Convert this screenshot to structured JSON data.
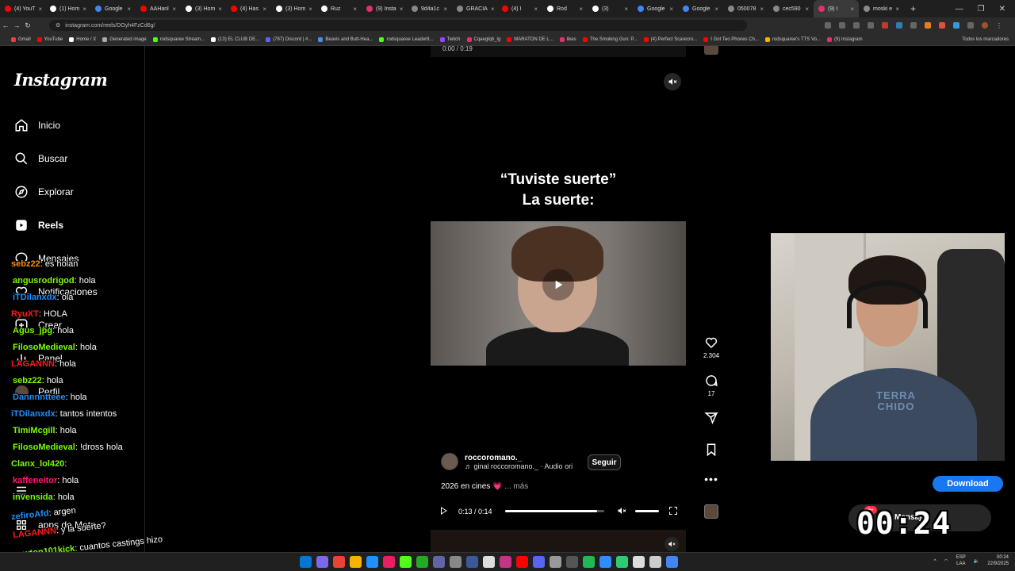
{
  "browser": {
    "tabs": [
      {
        "label": "(4) YouT",
        "color": "#ff0000"
      },
      {
        "label": "(1) Hom",
        "color": "#ffffff"
      },
      {
        "label": "Google",
        "color": "#4285f4"
      },
      {
        "label": "AAHanl",
        "color": "#ff0000"
      },
      {
        "label": "(3) Hom",
        "color": "#ffffff"
      },
      {
        "label": "(4) Has",
        "color": "#ff0000"
      },
      {
        "label": "(3) Hom",
        "color": "#ffffff"
      },
      {
        "label": "Ruz",
        "color": "#ffffff"
      },
      {
        "label": "(9) Insta",
        "color": "#e1306c"
      },
      {
        "label": "9d4a1c",
        "color": "#888888"
      },
      {
        "label": "GRACIA",
        "color": "#888888"
      },
      {
        "label": "(4) I",
        "color": "#ff0000"
      },
      {
        "label": "Rod",
        "color": "#ffffff"
      },
      {
        "label": "(3) ",
        "color": "#ffffff"
      },
      {
        "label": "Google",
        "color": "#4285f4"
      },
      {
        "label": "Google",
        "color": "#4285f4"
      },
      {
        "label": "050078",
        "color": "#888888"
      },
      {
        "label": "cec590",
        "color": "#888888"
      },
      {
        "label": "(9) I",
        "color": "#e1306c"
      },
      {
        "label": "moski e",
        "color": "#888888"
      }
    ],
    "active_tab_index": 18,
    "new_tab": "+",
    "url": "instagram.com/reels/DOyh4FzCd6g/",
    "bookmarks": [
      {
        "label": "Gmail",
        "color": "#ea4335"
      },
      {
        "label": "YouTube",
        "color": "#ff0000"
      },
      {
        "label": "Home / X",
        "color": "#ffffff"
      },
      {
        "label": "Generated image",
        "color": "#aaaaaa"
      },
      {
        "label": "rodsquaree Stream...",
        "color": "#53fc18"
      },
      {
        "label": "(13) EL CLUB DE...",
        "color": "#ffffff"
      },
      {
        "label": "(787) Discord | #...",
        "color": "#5865f2"
      },
      {
        "label": "Beavis and Butt-Hea...",
        "color": "#4a90e2"
      },
      {
        "label": "rodsquaree Leader8...",
        "color": "#53fc18"
      },
      {
        "label": "Twitch",
        "color": "#9146ff"
      },
      {
        "label": "Cqaeglqb_lg",
        "color": "#e1306c"
      },
      {
        "label": "MARATON DE L...",
        "color": "#ff0000"
      },
      {
        "label": "likes",
        "color": "#e1306c"
      },
      {
        "label": "The Smoking Gun: P...",
        "color": "#ff0000"
      },
      {
        "label": "(4) Perfect Scarecro...",
        "color": "#ff0000"
      },
      {
        "label": "I Got Teo Phones Ch...",
        "color": "#ff0000"
      },
      {
        "label": "rodsquaree's TTS Vo...",
        "color": "#f4b400"
      },
      {
        "label": "(9) Instagram",
        "color": "#e1306c"
      }
    ],
    "all_bookmarks": "Todos los marcadores"
  },
  "instagram": {
    "logo": "Instagram",
    "nav": [
      {
        "label": "Inicio",
        "icon": "home-icon"
      },
      {
        "label": "Buscar",
        "icon": "search-icon"
      },
      {
        "label": "Explorar",
        "icon": "compass-icon"
      },
      {
        "label": "Reels",
        "icon": "reels-icon"
      },
      {
        "label": "Mensajes",
        "icon": "messenger-icon"
      },
      {
        "label": "Notificaciones",
        "icon": "heart-icon"
      },
      {
        "label": "Crear",
        "icon": "plus-icon"
      },
      {
        "label": "Panel",
        "icon": "chart-icon"
      },
      {
        "label": "Perfil",
        "icon": "avatar"
      },
      {
        "label": "Más",
        "icon": "menu-icon"
      },
      {
        "label": "También de Meta",
        "icon": "grid-icon"
      }
    ],
    "nav_badge": "9+",
    "nav_mensajes_label": "Mensajes",
    "meta_apps_label": "apps de Meta"
  },
  "chat": [
    {
      "user": "sebz22",
      "msg": ": es holan",
      "color": "#ff8c00"
    },
    {
      "user": "angusrodrigod",
      "msg": ": hola",
      "color": "#7cfc00"
    },
    {
      "user": "iTDilanxdx",
      "msg": ": ola",
      "color": "#1e90ff"
    },
    {
      "user": "RyuXT",
      "msg": ": HOLA",
      "color": "#ff1a1a"
    },
    {
      "user": "Agus_jpg",
      "msg": ": hola",
      "color": "#7cfc00"
    },
    {
      "user": "FilosoMedieval",
      "msg": ": hola",
      "color": "#7cfc00"
    },
    {
      "user": "LAGANNN",
      "msg": ": hola",
      "color": "#ff1a1a"
    },
    {
      "user": "sebz22",
      "msg": ": hola",
      "color": "#7cfc00"
    },
    {
      "user": "Dannnntteee",
      "msg": ": hola",
      "color": "#1e90ff"
    },
    {
      "user": "iTDilanxdx",
      "msg": ": tantos intentos",
      "color": "#1e90ff"
    },
    {
      "user": "TimiMcgill",
      "msg": ": hola",
      "color": "#7cfc00"
    },
    {
      "user": "FilosoMedieval",
      "msg": ": !dross hola",
      "color": "#7cfc00"
    },
    {
      "user": "Clanx_lol420",
      "msg": ":",
      "color": "#7cfc00"
    },
    {
      "user": "kaffeneitor",
      "msg": ": hola",
      "color": "#ff1a6e"
    },
    {
      "user": "invensida",
      "msg": ": hola",
      "color": "#7cfc00"
    },
    {
      "user": "zefiroAfd",
      "msg": ": argen",
      "color": "#1e90ff"
    },
    {
      "user": "LAGANNN",
      "msg": ": y la suerte?",
      "color": "#ff1a1a"
    },
    {
      "user": "cowton101kick",
      "msg": ": cuantos castings hizo",
      "color": "#7cfc00"
    },
    {
      "user": "iTDilanxdx",
      "msg": ":",
      "color": "#1e90ff"
    }
  ],
  "reel": {
    "prev_time": "0:00 / 0:19",
    "title_line1": "“Tuviste suerte”",
    "title_line2": "La suerte:",
    "author": "roccoromano._",
    "audio": "♬ ginal     roccoromano._ · Audio ori",
    "follow": "Seguir",
    "caption": "2026 en cines 💗",
    "caption_more": "... más",
    "time": "0:13 / 0:14",
    "progress": 0.93,
    "likes": "2.304",
    "comments": "17"
  },
  "overlay": {
    "download": "Download",
    "messages_badge": "9+",
    "messages_label": "Mensajes",
    "timer": "00:24",
    "shirt_text": "TERRA CHIDO"
  },
  "taskbar": {
    "apps": [
      "#0078d4",
      "#7b68ee",
      "#ea4335",
      "#f4b400",
      "#1e90ff",
      "#e91e63",
      "#53fc18",
      "#22aa22",
      "#6264a7",
      "#888888",
      "#3b5998",
      "#dddddd",
      "#c13584",
      "#ff0000",
      "#5865f2",
      "#999999",
      "#555555",
      "#1db954",
      "#2d8cff",
      "#2ecc71",
      "#dddddd",
      "#cccccc",
      "#4285f4"
    ],
    "lang": "ESP",
    "lang2": "LAA",
    "time": "00:24",
    "date": "22/9/2025"
  }
}
